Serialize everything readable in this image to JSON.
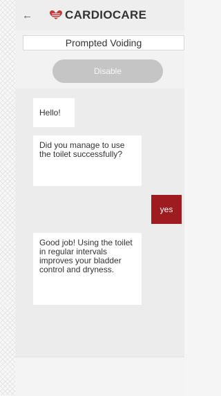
{
  "header": {
    "back_icon": "arrow-left-icon",
    "logo_icon": "heart-logo-icon",
    "brand": "CARDIOCARE"
  },
  "title": "Prompted Voiding",
  "disable_button": "Disable",
  "messages": [
    {
      "from": "bot",
      "text": "Hello!"
    },
    {
      "from": "bot",
      "text": "Did you manage to use the toilet successfully?"
    },
    {
      "from": "user",
      "text": "yes"
    },
    {
      "from": "bot",
      "text": "Good job! Using the toilet in regular intervals improves your bladder control and dryness."
    }
  ],
  "colors": {
    "user_bubble": "#9e1b20",
    "logo": "#c0393d"
  }
}
